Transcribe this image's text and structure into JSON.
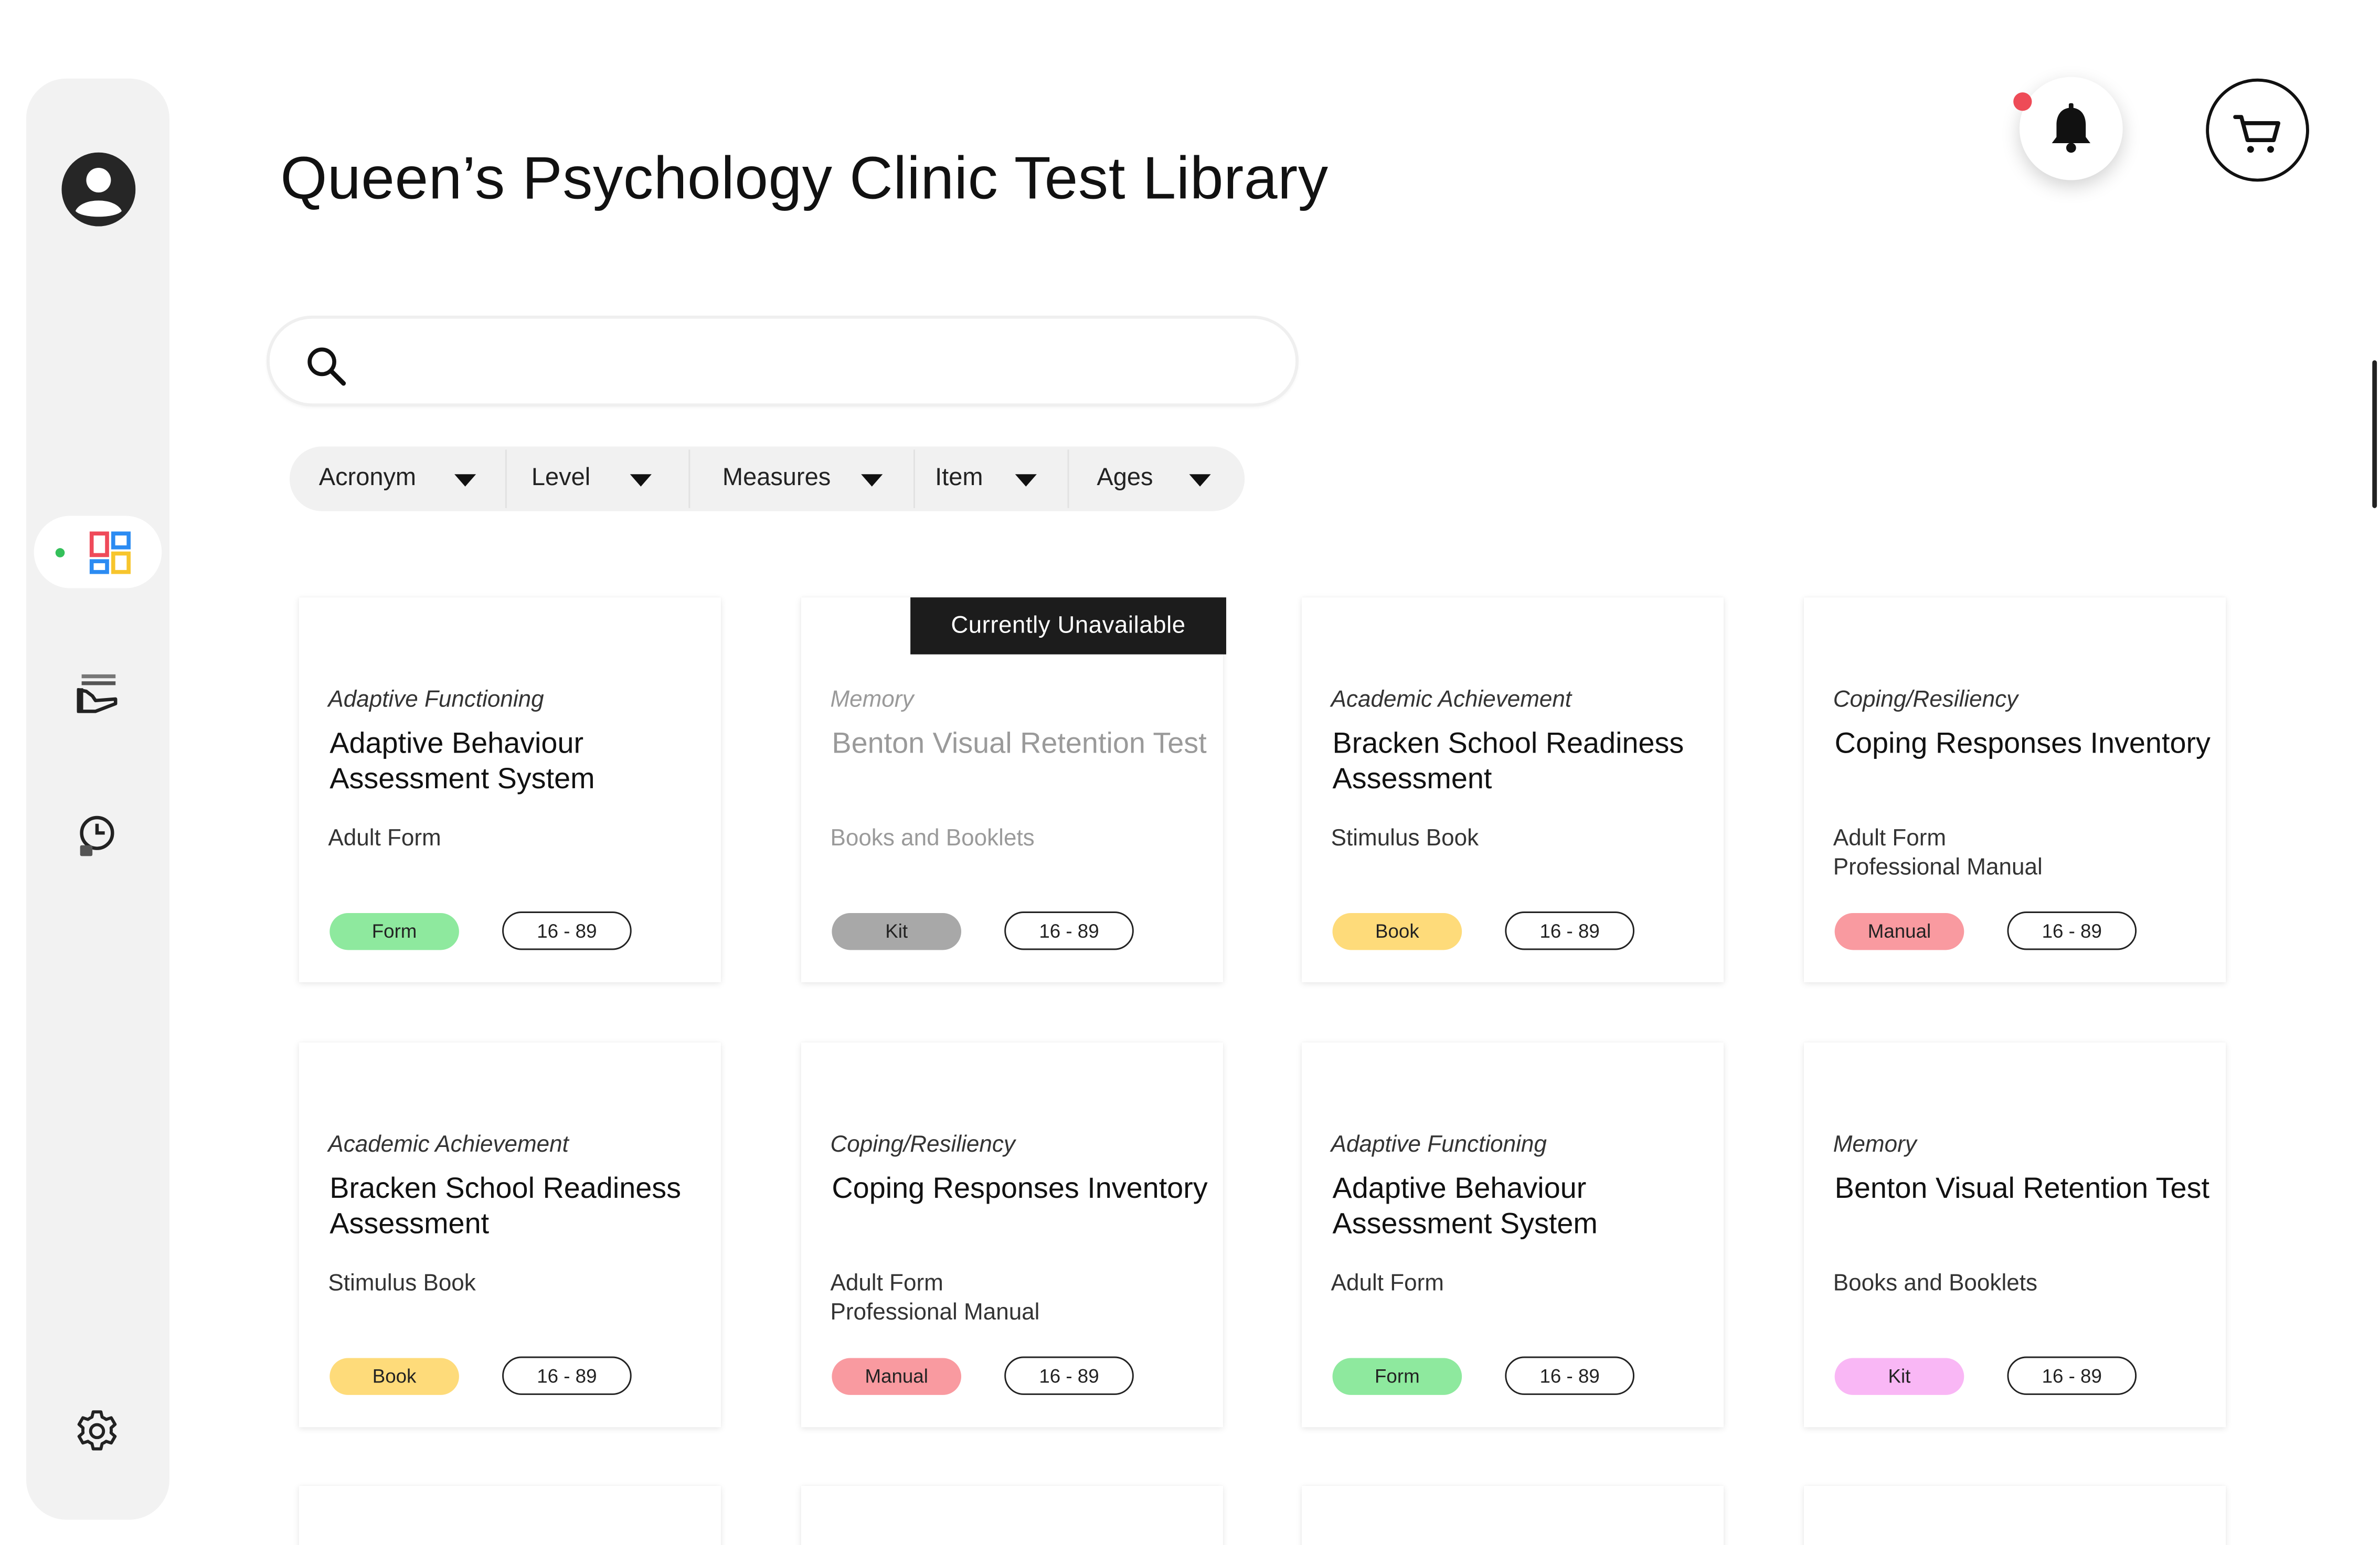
{
  "header": {
    "title": "Queen’s Psychology Clinic Test Library"
  },
  "search": {
    "placeholder": "",
    "value": ""
  },
  "filters": [
    {
      "label": "Acronym"
    },
    {
      "label": "Level"
    },
    {
      "label": "Measures"
    },
    {
      "label": "Item"
    },
    {
      "label": "Ages"
    }
  ],
  "sidebar": {
    "items": [
      {
        "icon": "user-avatar-icon"
      },
      {
        "icon": "dashboard-icon",
        "active": true
      },
      {
        "icon": "hand-stack-icon"
      },
      {
        "icon": "clock-history-icon"
      },
      {
        "icon": "gear-icon"
      }
    ]
  },
  "notifications": {
    "has_unread": true
  },
  "colors": {
    "form": "#8ee99e",
    "kit_unavailable": "#a8a8a8",
    "book": "#fedb7a",
    "manual": "#f99aa0",
    "kit": "#f9b7f5",
    "active_dot": "#34c05a",
    "notification_dot": "#ee4b57"
  },
  "cards": [
    {
      "category": "Adaptive Functioning",
      "title": "Adaptive Behaviour Assessment System",
      "subs": [
        "Adult Form"
      ],
      "type": "Form",
      "type_color": "#8ee99e",
      "ages": "16 - 89",
      "unavailable": false
    },
    {
      "category": "Memory",
      "title": "Benton Visual Retention Test",
      "subs": [
        "Books and Booklets"
      ],
      "type": "Kit",
      "type_color": "#a8a8a8",
      "ages": "16 - 89",
      "unavailable": true,
      "unavailable_label": "Currently Unavailable"
    },
    {
      "category": "Academic Achievement",
      "title": "Bracken School Readiness Assessment",
      "subs": [
        "Stimulus Book"
      ],
      "type": "Book",
      "type_color": "#fedb7a",
      "ages": "16 - 89",
      "unavailable": false
    },
    {
      "category": "Coping/Resiliency",
      "title": "Coping Responses Inventory",
      "subs": [
        "Adult Form",
        "Professional Manual"
      ],
      "type": "Manual",
      "type_color": "#f99aa0",
      "ages": "16 - 89",
      "unavailable": false
    },
    {
      "category": "Academic Achievement",
      "title": "Bracken School Readiness Assessment",
      "subs": [
        "Stimulus Book"
      ],
      "type": "Book",
      "type_color": "#fedb7a",
      "ages": "16 - 89",
      "unavailable": false
    },
    {
      "category": "Coping/Resiliency",
      "title": "Coping Responses Inventory",
      "subs": [
        "Adult Form",
        "Professional Manual"
      ],
      "type": "Manual",
      "type_color": "#f99aa0",
      "ages": "16 - 89",
      "unavailable": false
    },
    {
      "category": "Adaptive Functioning",
      "title": "Adaptive Behaviour Assessment System",
      "subs": [
        "Adult Form"
      ],
      "type": "Form",
      "type_color": "#8ee99e",
      "ages": "16 - 89",
      "unavailable": false
    },
    {
      "category": "Memory",
      "title": "Benton Visual Retention Test",
      "subs": [
        "Books and Booklets"
      ],
      "type": "Kit",
      "type_color": "#f9b7f5",
      "ages": "16 - 89",
      "unavailable": false
    }
  ]
}
